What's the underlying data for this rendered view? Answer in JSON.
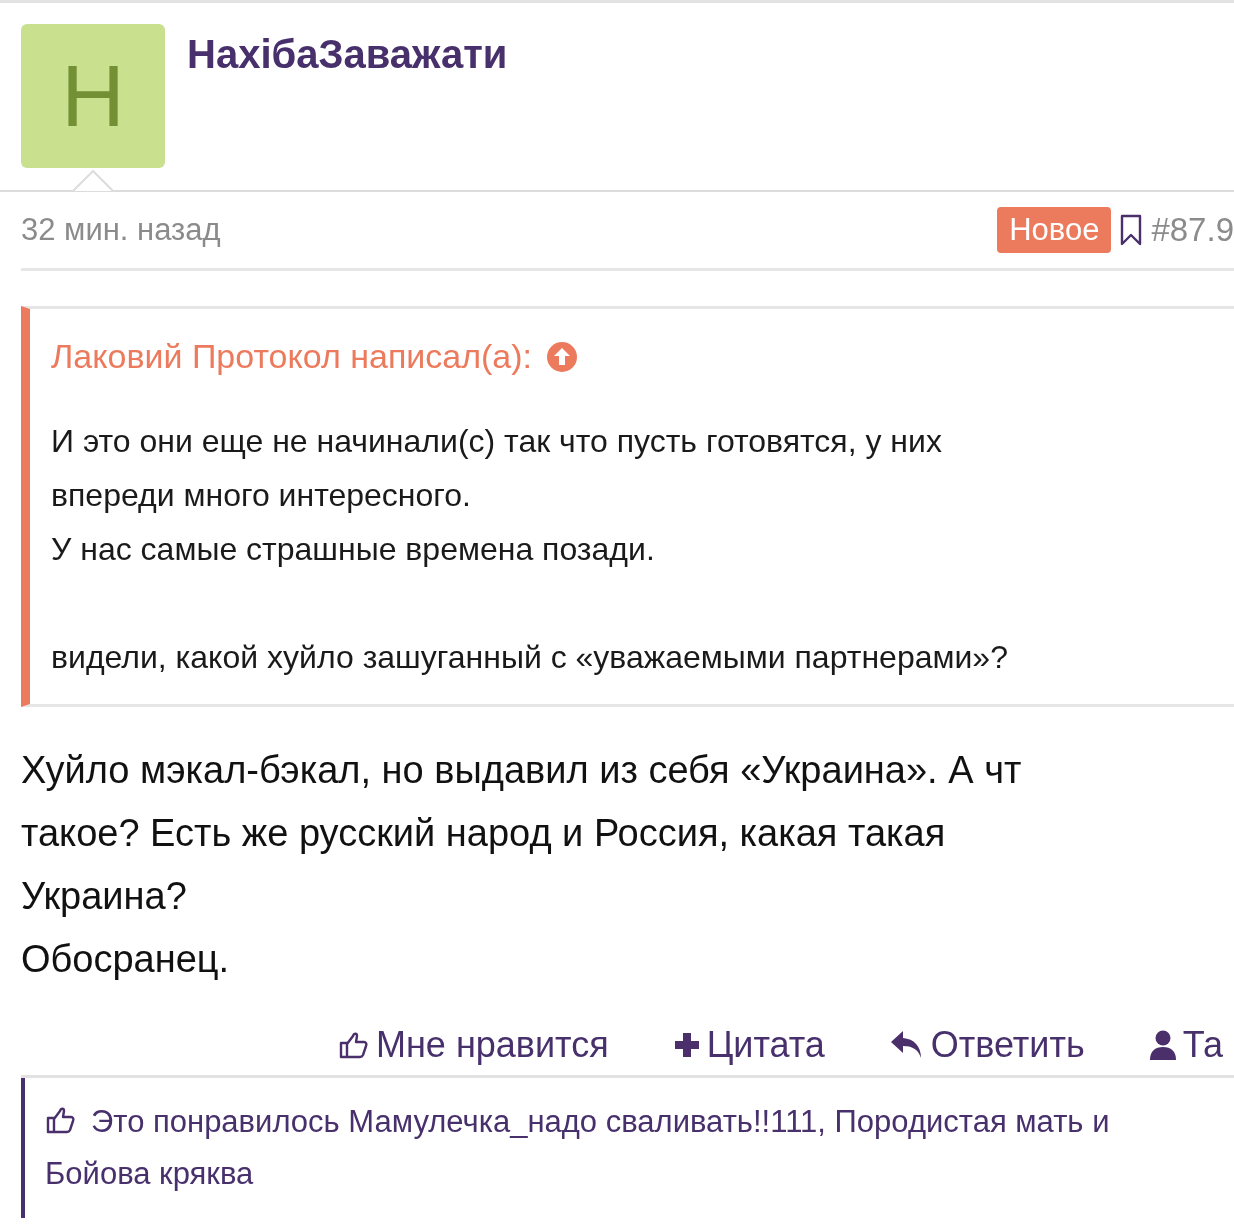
{
  "post": {
    "avatar_letter": "H",
    "username": "НахібаЗаважати",
    "time": "32 мин. назад",
    "badge": "Новое",
    "post_number": "#87.9"
  },
  "quote": {
    "author": "Лаковий Протокол написал(а):",
    "paragraphs": [
      [
        "И это они еще не начинали(с) так что пусть готовятся, у них",
        "впереди много интересного.",
        "У нас самые страшные времена позади."
      ],
      [
        "видели, какой хуйло зашуганный с «уважаемыми партнерами»?"
      ]
    ]
  },
  "body_lines": [
    "Хуйло мэкал-бэкал, но выдавил из себя «Украина». А чт",
    "такое? Есть же русский народ и Россия, какая такая",
    "Украина?",
    "Обосранец."
  ],
  "actions": [
    {
      "kind": "like",
      "label": "Мне нравится"
    },
    {
      "kind": "quote",
      "label": "Цитата"
    },
    {
      "kind": "reply",
      "label": "Ответить"
    },
    {
      "kind": "user",
      "label": "Та"
    }
  ],
  "likes": {
    "text": "Это понравилось Мамулечка_надо сваливать!!111, Породистая мать и Бойова кряква"
  }
}
